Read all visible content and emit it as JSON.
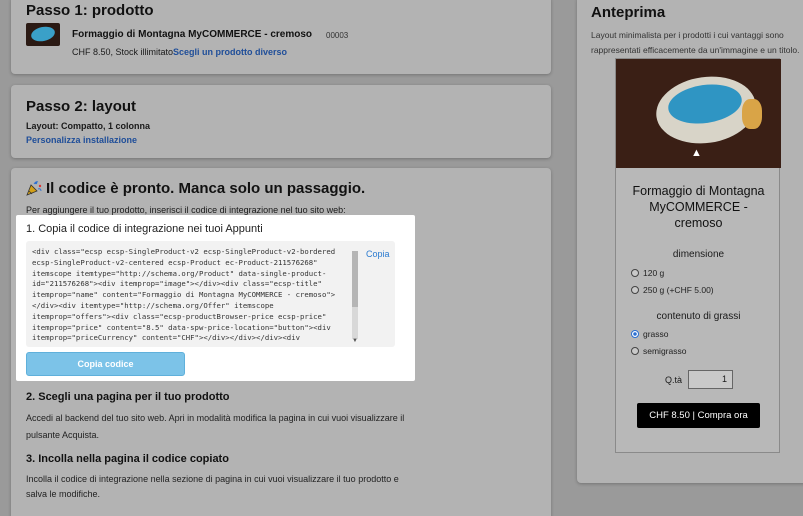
{
  "step1": {
    "title": "Passo 1: prodotto",
    "product_name": "Formaggio di Montagna MyCOMMERCE - cremoso",
    "product_code": "00003",
    "product_meta": "CHF 8.50, Stock illimitato",
    "change_link": "Scegli un prodotto diverso"
  },
  "step2": {
    "title": "Passo 2: layout",
    "layout_line": "Layout: Compatto, 1 colonna",
    "customize_link": "Personalizza installazione"
  },
  "step3": {
    "title": "Il codice è pronto. Manca solo un passaggio.",
    "intro": "Per aggiungere il tuo prodotto, inserisci il codice di integrazione nel tuo sito web:",
    "copy_title": "1. Copia il codice di integrazione nei tuoi Appunti",
    "code": "<div class=\"ecsp ecsp-SingleProduct-v2 ecsp-SingleProduct-v2-bordered\necsp-SingleProduct-v2-centered ecsp-Product ec-Product-211576268\"\nitemscope itemtype=\"http://schema.org/Product\" data-single-product-\nid=\"211576268\"><div itemprop=\"image\"></div><div class=\"ecsp-title\"\nitemprop=\"name\" content=\"Formaggio di Montagna MyCOMMERCE - cremoso\">\n</div><div itemtype=\"http://schema.org/Offer\" itemscope\nitemprop=\"offers\"><div class=\"ecsp-productBrowser-price ecsp-price\"\nitemprop=\"price\" content=\"8.5\" data-spw-price-location=\"button\"><div\nitemprop=\"priceCurrency\" content=\"CHF\"></div></div></div><div",
    "copy_link": "Copia",
    "copy_button": "Copia codice",
    "choose_title": "2. Scegli una pagina per il tuo prodotto",
    "choose_text": "Accedi al backend del tuo sito web. Apri in modalità modifica la pagina in cui vuoi visualizzare il pulsante Acquista.",
    "paste_title": "3. Incolla nella pagina il codice copiato",
    "paste_text": "Incolla il codice di integrazione nella sezione di pagina in cui vuoi visualizzare il tuo prodotto e salva le modifiche."
  },
  "preview": {
    "title": "Anteprima",
    "description": "Layout minimalista per i prodotti i cui vantaggi sono rappresentati efficacemente da un'immagine e un titolo.",
    "product_name": "Formaggio di Montagna MyCOMMERCE - cremoso",
    "size_label": "dimensione",
    "size_options": [
      "120 g",
      "250 g (+CHF 5.00)"
    ],
    "size_selected": null,
    "fat_label": "contenuto di grassi",
    "fat_options": [
      "grasso",
      "semigrasso"
    ],
    "fat_selected": "grasso",
    "qty_label": "Q.tà",
    "qty_value": "1",
    "buy_button": "CHF 8.50 | Compra ora"
  },
  "colors": {
    "link": "#1f4e99",
    "copy_button": "#7cc3e8",
    "buy_button": "#000000",
    "overlay_background": "#9a9a9a"
  }
}
